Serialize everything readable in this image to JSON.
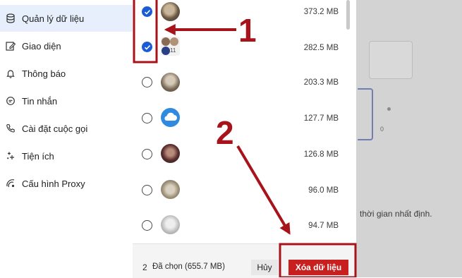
{
  "sidebar": {
    "items": [
      {
        "label": "Quản lý dữ liệu",
        "icon": "database-icon",
        "active": true
      },
      {
        "label": "Giao diện",
        "icon": "pencil-square-icon"
      },
      {
        "label": "Thông báo",
        "icon": "bell-icon"
      },
      {
        "label": "Tin nhắn",
        "icon": "chat-bubble-icon"
      },
      {
        "label": "Cài đặt cuộc gọi",
        "icon": "phone-icon"
      },
      {
        "label": "Tiện ích",
        "icon": "sparkle-icon"
      },
      {
        "label": "Cấu hình Proxy",
        "icon": "proxy-icon"
      }
    ]
  },
  "conversations": [
    {
      "size": "373.2 MB",
      "checked": true
    },
    {
      "size": "282.5 MB",
      "checked": true,
      "badge": "11"
    },
    {
      "size": "203.3 MB",
      "checked": false
    },
    {
      "size": "127.7 MB",
      "checked": false
    },
    {
      "size": "126.8 MB",
      "checked": false
    },
    {
      "size": "96.0 MB",
      "checked": false
    },
    {
      "size": "94.7 MB",
      "checked": false
    }
  ],
  "footer": {
    "selected_count": "2",
    "selected_text": "Đã chọn (655.7 MB)",
    "cancel_label": "Hủy",
    "delete_label": "Xóa dữ liệu"
  },
  "background": {
    "partial_text": "thời gian nhất định.",
    "digit": "0"
  },
  "annotations": {
    "step1": "1",
    "step2": "2",
    "color": "#a8121a"
  }
}
